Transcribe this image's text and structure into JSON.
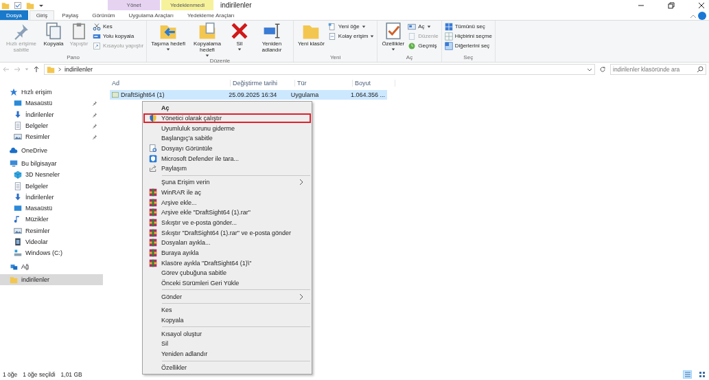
{
  "window": {
    "title": "indirilenler"
  },
  "context_tabs": [
    {
      "label": "Yönet",
      "color": "#e6d3f2"
    },
    {
      "label": "Yedeklenmedi",
      "color": "#f6f29c"
    }
  ],
  "tabs": [
    {
      "label": "Dosya",
      "kind": "file",
      "selected": false
    },
    {
      "label": "Giriş",
      "kind": "tab",
      "selected": true
    },
    {
      "label": "Paylaş",
      "kind": "tab",
      "selected": false
    },
    {
      "label": "Görünüm",
      "kind": "tab",
      "selected": false
    },
    {
      "label": "Uygulama Araçları",
      "kind": "tab",
      "selected": false
    },
    {
      "label": "Yedekleme Araçları",
      "kind": "tab",
      "selected": false
    }
  ],
  "ribbon": {
    "groups": [
      {
        "label": "Pano",
        "items": [
          {
            "kind": "large",
            "label": "Hızlı erişime sabitle",
            "dropdown": false,
            "disabled": true
          },
          {
            "kind": "large",
            "label": "Kopyala",
            "dropdown": false,
            "disabled": false
          },
          {
            "kind": "large",
            "label": "Yapıştır",
            "dropdown": false,
            "disabled": true
          },
          {
            "kind": "stack",
            "items": [
              {
                "label": "Kes",
                "dropdown": false,
                "disabled": false
              },
              {
                "label": "Yolu kopyala",
                "dropdown": false,
                "disabled": false
              },
              {
                "label": "Kısayolu yapıştır",
                "dropdown": false,
                "disabled": true
              }
            ]
          }
        ]
      },
      {
        "label": "Düzenle",
        "items": [
          {
            "kind": "large",
            "label": "Taşıma hedefi",
            "dropdown": true,
            "disabled": false
          },
          {
            "kind": "large",
            "label": "Kopyalama hedefi",
            "dropdown": true,
            "disabled": false
          },
          {
            "kind": "large",
            "label": "Sil",
            "dropdown": true,
            "disabled": false
          },
          {
            "kind": "large",
            "label": "Yeniden adlandır",
            "dropdown": false,
            "disabled": false
          }
        ]
      },
      {
        "label": "Yeni",
        "items": [
          {
            "kind": "large",
            "label": "Yeni klasör",
            "dropdown": false,
            "disabled": false
          },
          {
            "kind": "stack",
            "items": [
              {
                "label": "Yeni öğe",
                "dropdown": true,
                "disabled": false
              },
              {
                "label": "Kolay erişim",
                "dropdown": true,
                "disabled": false
              }
            ]
          }
        ]
      },
      {
        "label": "Aç",
        "items": [
          {
            "kind": "large",
            "label": "Özellikler",
            "dropdown": true,
            "disabled": false
          },
          {
            "kind": "stack",
            "items": [
              {
                "label": "Aç",
                "dropdown": true,
                "disabled": false
              },
              {
                "label": "Düzenle",
                "dropdown": false,
                "disabled": true
              },
              {
                "label": "Geçmiş",
                "dropdown": false,
                "disabled": false
              }
            ]
          }
        ]
      },
      {
        "label": "Seç",
        "items": [
          {
            "kind": "stack",
            "items": [
              {
                "label": "Tümünü seç",
                "dropdown": false,
                "disabled": false
              },
              {
                "label": "Hiçbirini seçme",
                "dropdown": false,
                "disabled": false
              },
              {
                "label": "Diğerlerini seç",
                "dropdown": false,
                "disabled": false
              }
            ]
          }
        ]
      }
    ]
  },
  "address": {
    "path": "indirilenler"
  },
  "search": {
    "placeholder": "indirilenler klasöründe ara"
  },
  "sidebar": {
    "items": [
      {
        "label": "Hızlı erişim",
        "kind": "star",
        "selected": false,
        "children": [
          {
            "label": "Masaüstü",
            "kind": "desktop",
            "selected": false,
            "pinned": true
          },
          {
            "label": "İndirilenler",
            "kind": "download",
            "selected": false,
            "pinned": true
          },
          {
            "label": "Belgeler",
            "kind": "docs",
            "selected": false,
            "pinned": true
          },
          {
            "label": "Resimler",
            "kind": "pictures",
            "selected": false,
            "pinned": true
          }
        ]
      },
      {
        "label": "OneDrive",
        "kind": "cloud",
        "selected": false
      },
      {
        "label": "Bu bilgisayar",
        "kind": "pc",
        "selected": false,
        "children": [
          {
            "label": "3D Nesneler",
            "kind": "cube",
            "selected": false
          },
          {
            "label": "Belgeler",
            "kind": "docs",
            "selected": false
          },
          {
            "label": "İndirilenler",
            "kind": "download",
            "selected": false
          },
          {
            "label": "Masaüstü",
            "kind": "desktop",
            "selected": false
          },
          {
            "label": "Müzikler",
            "kind": "music",
            "selected": false
          },
          {
            "label": "Resimler",
            "kind": "pictures",
            "selected": false
          },
          {
            "label": "Videolar",
            "kind": "video",
            "selected": false
          },
          {
            "label": "Windows (C:)",
            "kind": "drive",
            "selected": false
          }
        ]
      },
      {
        "label": "Ağ",
        "kind": "network",
        "selected": false
      },
      {
        "label": "indirilenler",
        "kind": "folder",
        "selected": true
      }
    ]
  },
  "table": {
    "columns": [
      "Ad",
      "Değiştirme tarihi",
      "Tür",
      "Boyut"
    ],
    "rows": [
      {
        "cells": [
          "DraftSight64 (1)",
          "25.09.2025 16:34",
          "Uygulama",
          "1.064.356 ..."
        ],
        "selected": true
      }
    ]
  },
  "context_menu": {
    "items": [
      {
        "kind": "plain",
        "label": "Aç",
        "default": true,
        "highlighted": false,
        "submenu": false
      },
      {
        "kind": "shield",
        "label": "Yönetici olarak çalıştır",
        "default": false,
        "highlighted": true,
        "submenu": false
      },
      {
        "kind": "plain",
        "label": "Uyumluluk sorunu giderme",
        "default": false,
        "highlighted": false,
        "submenu": false
      },
      {
        "kind": "plain",
        "label": "Başlangıç'a sabitle",
        "default": false,
        "highlighted": false,
        "submenu": false
      },
      {
        "kind": "view",
        "label": "Dosyayı Görüntüle",
        "default": false,
        "highlighted": false,
        "submenu": false
      },
      {
        "kind": "defender",
        "label": "Microsoft Defender ile tara...",
        "default": false,
        "highlighted": false,
        "submenu": false
      },
      {
        "kind": "share",
        "label": "Paylaşım",
        "default": false,
        "highlighted": false,
        "submenu": false
      },
      {
        "kind": "separator"
      },
      {
        "kind": "plain",
        "label": "Şuna Erişim verin",
        "default": false,
        "highlighted": false,
        "submenu": true
      },
      {
        "kind": "winrar",
        "label": "WinRAR ile aç",
        "default": false,
        "highlighted": false,
        "submenu": false
      },
      {
        "kind": "winrar",
        "label": "Arşive ekle...",
        "default": false,
        "highlighted": false,
        "submenu": false
      },
      {
        "kind": "winrar",
        "label": "Arşive ekle \"DraftSight64 (1).rar\"",
        "default": false,
        "highlighted": false,
        "submenu": false
      },
      {
        "kind": "winrar",
        "label": "Sıkıştır ve e-posta gönder...",
        "default": false,
        "highlighted": false,
        "submenu": false
      },
      {
        "kind": "winrar",
        "label": "Sıkıştır \"DraftSight64 (1).rar\" ve e-posta gönder",
        "default": false,
        "highlighted": false,
        "submenu": false
      },
      {
        "kind": "winrar",
        "label": "Dosyaları ayıkla...",
        "default": false,
        "highlighted": false,
        "submenu": false
      },
      {
        "kind": "winrar",
        "label": "Buraya ayıkla",
        "default": false,
        "highlighted": false,
        "submenu": false
      },
      {
        "kind": "winrar",
        "label": "Klasöre ayıkla \"DraftSight64 (1)\\\"",
        "default": false,
        "highlighted": false,
        "submenu": false
      },
      {
        "kind": "plain",
        "label": "Görev çubuğuna sabitle",
        "default": false,
        "highlighted": false,
        "submenu": false
      },
      {
        "kind": "plain",
        "label": "Önceki Sürümleri Geri Yükle",
        "default": false,
        "highlighted": false,
        "submenu": false
      },
      {
        "kind": "separator"
      },
      {
        "kind": "plain",
        "label": "Gönder",
        "default": false,
        "highlighted": false,
        "submenu": true
      },
      {
        "kind": "separator"
      },
      {
        "kind": "plain",
        "label": "Kes",
        "default": false,
        "highlighted": false,
        "submenu": false
      },
      {
        "kind": "plain",
        "label": "Kopyala",
        "default": false,
        "highlighted": false,
        "submenu": false
      },
      {
        "kind": "separator"
      },
      {
        "kind": "plain",
        "label": "Kısayol oluştur",
        "default": false,
        "highlighted": false,
        "submenu": false
      },
      {
        "kind": "plain",
        "label": "Sil",
        "default": false,
        "highlighted": false,
        "submenu": false
      },
      {
        "kind": "plain",
        "label": "Yeniden adlandır",
        "default": false,
        "highlighted": false,
        "submenu": false
      },
      {
        "kind": "separator"
      },
      {
        "kind": "plain",
        "label": "Özellikler",
        "default": false,
        "highlighted": false,
        "submenu": false
      }
    ]
  },
  "status_bar": {
    "items": [
      "1 öğe",
      "1 öğe seçildi",
      "1,01 GB"
    ],
    "views": [
      {
        "kind": "details",
        "selected": true
      },
      {
        "kind": "large",
        "selected": false
      }
    ]
  }
}
